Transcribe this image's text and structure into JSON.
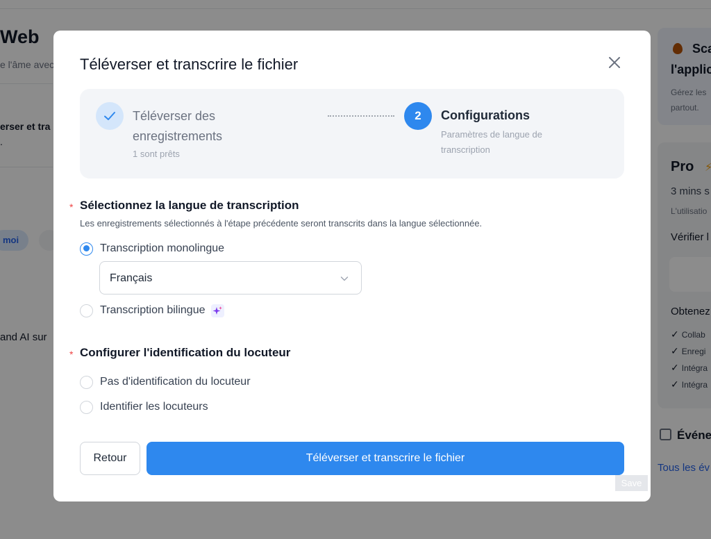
{
  "background": {
    "page_title": "Web",
    "page_subtitle": "e l'âme avec",
    "upload_text": "erser et tra",
    "upload_dot": ".",
    "chip_label": "moi",
    "brand_text": "and AI sur",
    "promo_card": {
      "title": "Sca",
      "title_line2": "l'applic",
      "desc_line1": "Gérez les",
      "desc_line2": "partout."
    },
    "plan_card": {
      "plan": "Pro",
      "mins": "3 mins s",
      "usage": "L'utilisatio",
      "verify": "Vérifier l",
      "obtain": "Obtenez",
      "features": [
        "Collab",
        "Enregi",
        "Intégra",
        "Intégra"
      ]
    },
    "events_title": "Événe",
    "all_events_link": "Tous les év"
  },
  "modal": {
    "title": "Téléverser et transcrire le fichier",
    "steps": [
      {
        "title": "Téléverser des enregistrements",
        "subtitle": "1 sont prêts",
        "status": "done"
      },
      {
        "number": "2",
        "title": "Configurations",
        "subtitle": "Paramètres de langue de transcription",
        "status": "active"
      }
    ],
    "language_section": {
      "required_mark": "*",
      "title": "Sélectionnez la langue de transcription",
      "description": "Les enregistrements sélectionnés à l'étape précédente seront transcrits dans la langue sélectionnée.",
      "option_mono": "Transcription monolingue",
      "selected_language": "Français",
      "option_bilingual": "Transcription bilingue"
    },
    "speaker_section": {
      "required_mark": "*",
      "title": "Configurer l'identification du locuteur",
      "option_none": "Pas d'identification du locuteur",
      "option_identify": "Identifier les locuteurs"
    },
    "buttons": {
      "back": "Retour",
      "submit": "Téléverser et transcrire le fichier"
    }
  },
  "save_badge": "Save",
  "colors": {
    "accent": "#2e88ee",
    "overlay": "rgba(0,0,0,0.45)",
    "required": "#ef4444"
  }
}
